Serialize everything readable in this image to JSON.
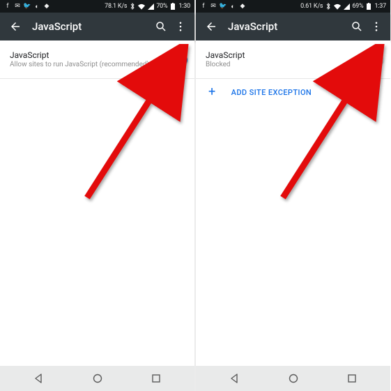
{
  "screens": [
    {
      "statusbar": {
        "net_speed": "78.1 K/s",
        "battery": "70%",
        "clock": "1:30"
      },
      "toolbar": {
        "title": "JavaScript"
      },
      "setting": {
        "title": "JavaScript",
        "subtitle": "Allow sites to run JavaScript (recommended)",
        "enabled": true
      }
    },
    {
      "statusbar": {
        "net_speed": "0.61 K/s",
        "battery": "69%",
        "clock": "1:37"
      },
      "toolbar": {
        "title": "JavaScript"
      },
      "setting": {
        "title": "JavaScript",
        "subtitle": "Blocked",
        "enabled": false
      },
      "add_exception_label": "ADD SITE EXCEPTION"
    }
  ]
}
